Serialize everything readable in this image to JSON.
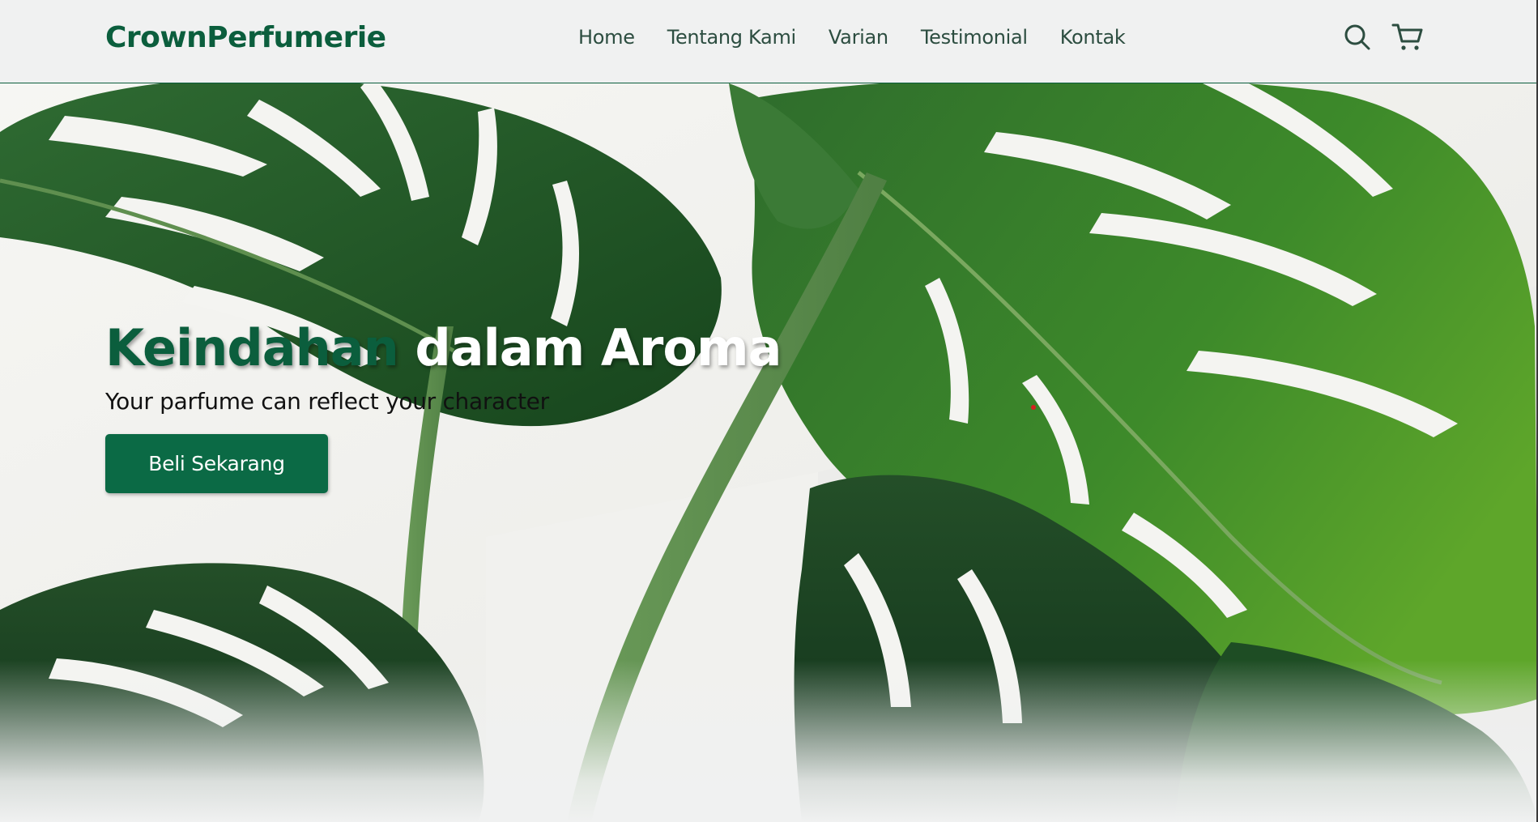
{
  "brand": {
    "name": "CrownPerfumerie",
    "color": "#0b5e3d"
  },
  "nav": {
    "items": [
      {
        "label": "Home"
      },
      {
        "label": "Tentang Kami"
      },
      {
        "label": "Varian"
      },
      {
        "label": "Testimonial"
      },
      {
        "label": "Kontak"
      }
    ],
    "icons": [
      "search-icon",
      "cart-icon"
    ]
  },
  "hero": {
    "title_accent": "Keindahan",
    "title_rest": " dalam Aroma",
    "subtitle": "Your parfume can reflect your character",
    "cta_label": "Beli Sekarang",
    "background": "monstera-leaves-photo"
  },
  "colors": {
    "accent": "#0b5e3d",
    "button": "#0b6a45",
    "nav_text": "#2c4d40",
    "page_bg": "#f0f1f1"
  }
}
